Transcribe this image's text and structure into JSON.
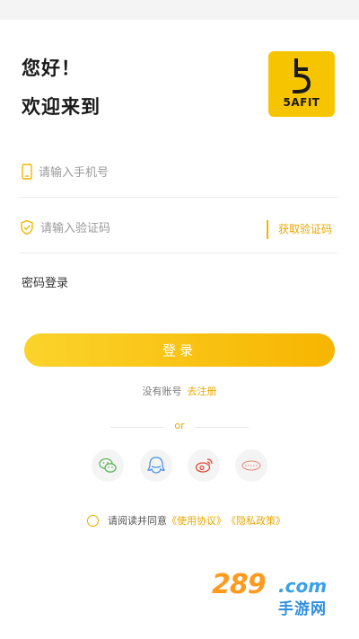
{
  "greeting": {
    "line1": "您好！",
    "line2": "欢迎来到"
  },
  "logo": {
    "text": "5AFIT",
    "icon": "brand-logo-icon",
    "color": "#f7c500"
  },
  "phone_field": {
    "icon": "phone-icon",
    "placeholder": "请输入手机号",
    "value": ""
  },
  "code_field": {
    "icon": "shield-check-icon",
    "placeholder": "请输入验证码",
    "value": "",
    "get_code_label": "获取验证码"
  },
  "password_login_label": "密码登录",
  "login_button_label": "登录",
  "register": {
    "prompt": "没有账号",
    "link": "去注册"
  },
  "or_label": "or",
  "social_logins": [
    {
      "name": "wechat",
      "icon": "wechat-icon",
      "color": "#5cb85c"
    },
    {
      "name": "qq",
      "icon": "qq-icon",
      "color": "#4a90e2"
    },
    {
      "name": "weibo",
      "icon": "weibo-icon",
      "color": "#e04b3a"
    },
    {
      "name": "other",
      "icon": "other-login-icon",
      "color": "#e88a7a"
    }
  ],
  "agreement": {
    "prefix": "请阅读并同意",
    "terms": "《使用协议》",
    "privacy": "《隐私政策》",
    "checked": false
  },
  "watermark": {
    "number": "289",
    "domain": ".com",
    "name": "手游网"
  },
  "colors": {
    "accent": "#e9a800",
    "button_start": "#fbd32b",
    "button_end": "#f7b500"
  }
}
